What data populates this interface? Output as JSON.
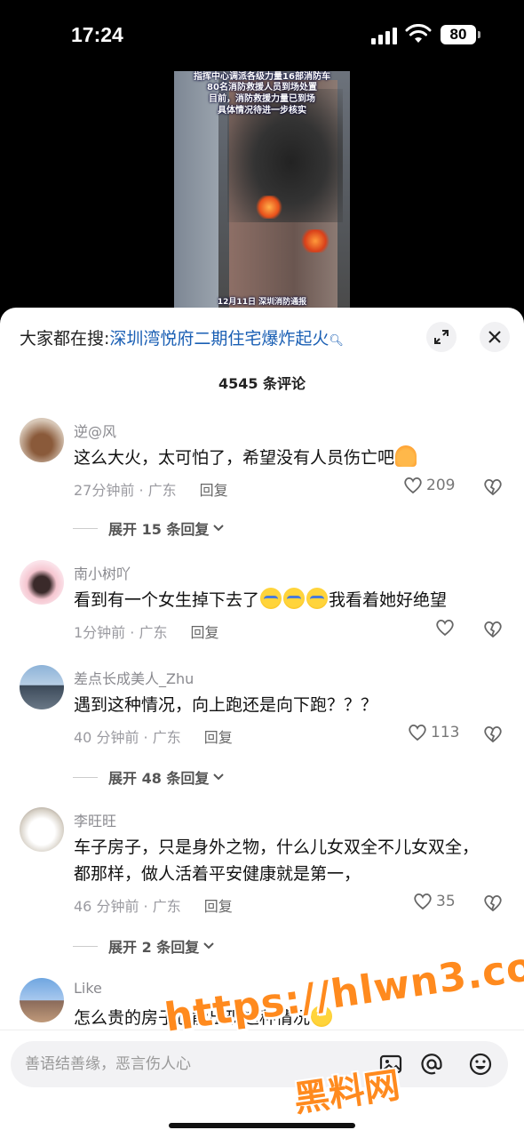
{
  "status": {
    "time": "17:24",
    "battery": "80"
  },
  "video": {
    "caption_top_1": "指挥中心调派各级力量16部消防车",
    "caption_top_2": "80名消防救援人员到场处置",
    "caption_mid_1": "目前，消防救援力量已到场",
    "caption_mid_2": "具体情况待进一步核实",
    "caption_bottom": "12月11日 深圳消防通报"
  },
  "search": {
    "prefix": "大家都在搜:",
    "keyword": "深圳湾悦府二期住宅爆炸起火"
  },
  "comments_count": "4545 条评论",
  "comments": [
    {
      "name": "逆@风",
      "text": "这么大火，太可怕了，希望没有人员伤亡吧",
      "time_loc": "27分钟前 · 广东",
      "reply": "回复",
      "likes": "209",
      "expand": "展开 15 条回复"
    },
    {
      "name": "南小树吖",
      "text": "看到有一个女生掉下去了",
      "text_after": "我看着她好绝望",
      "time_loc": "1分钟前 · 广东",
      "reply": "回复",
      "likes": ""
    },
    {
      "name": "差点长成美人_Zhu",
      "text": "遇到这种情况，向上跑还是向下跑？？？",
      "time_loc": "40 分钟前 · 广东",
      "reply": "回复",
      "likes": "113",
      "expand": "展开 48 条回复"
    },
    {
      "name": "李旺旺",
      "text": "车子房子，只是身外之物，什么儿女双全不儿女双全，都那样，做人活着平安健康就是第一，",
      "time_loc": "46 分钟前 · 广东",
      "reply": "回复",
      "likes": "35",
      "expand": "展开 2 条回复"
    },
    {
      "name": "Like",
      "text": "怎么贵的房子也能出现这种情况"
    }
  ],
  "input": {
    "placeholder": "善语结善缘，恶言伤人心"
  },
  "watermark": {
    "line1": "https://hlwn3.com",
    "line2": "黑料网"
  }
}
